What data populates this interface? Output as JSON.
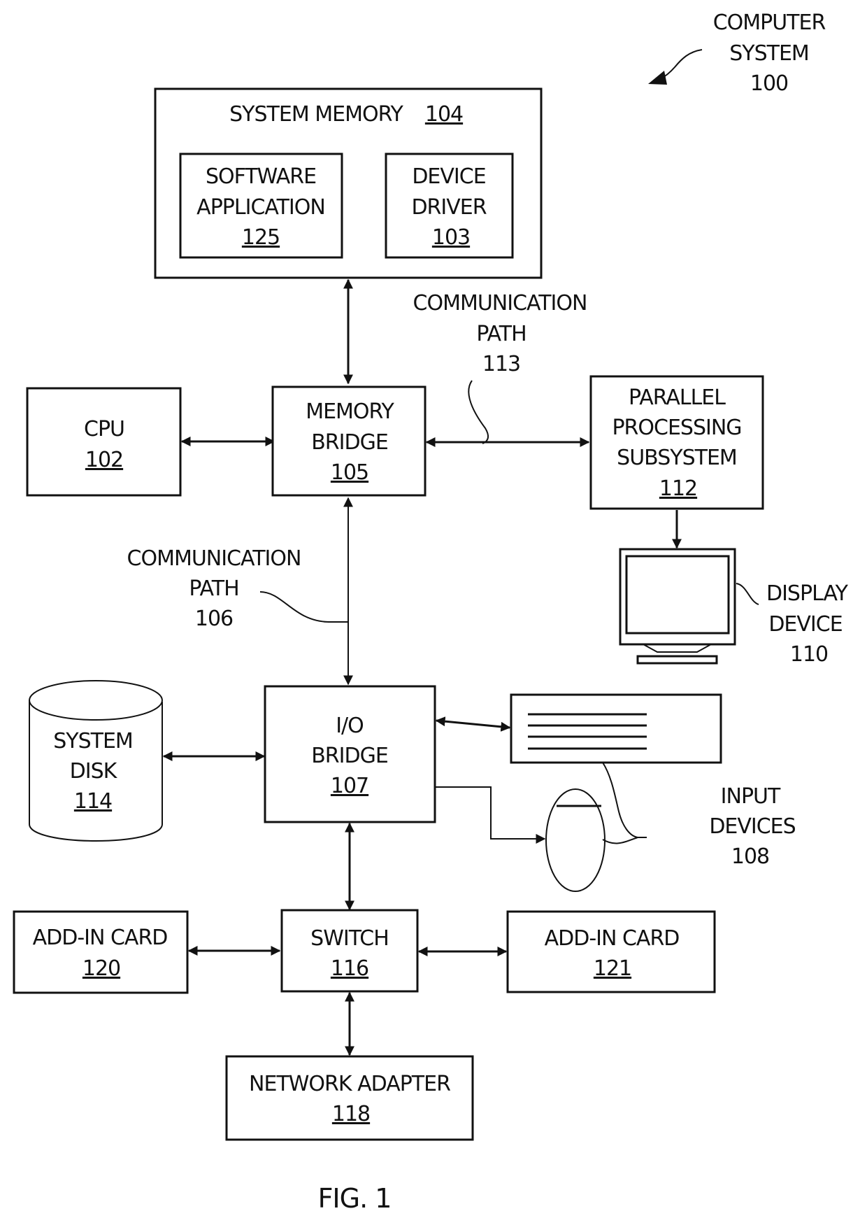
{
  "figure": {
    "caption": "FIG. 1",
    "title_lines": [
      "COMPUTER",
      "SYSTEM",
      "100"
    ]
  },
  "blocks": {
    "system_memory": {
      "name": "SYSTEM MEMORY",
      "ref": "104"
    },
    "software_application": {
      "lines": [
        "SOFTWARE",
        "APPLICATION"
      ],
      "ref": "125"
    },
    "device_driver": {
      "lines": [
        "DEVICE",
        "DRIVER"
      ],
      "ref": "103"
    },
    "cpu": {
      "lines": [
        "CPU"
      ],
      "ref": "102"
    },
    "memory_bridge": {
      "lines": [
        "MEMORY",
        "BRIDGE"
      ],
      "ref": "105"
    },
    "parallel_processing": {
      "lines": [
        "PARALLEL",
        "PROCESSING",
        "SUBSYSTEM"
      ],
      "ref": "112"
    },
    "display_device": {
      "lines": [
        "DISPLAY",
        "DEVICE",
        "110"
      ]
    },
    "system_disk": {
      "lines": [
        "SYSTEM",
        "DISK"
      ],
      "ref": "114"
    },
    "io_bridge": {
      "lines": [
        "I/O",
        "BRIDGE"
      ],
      "ref": "107"
    },
    "input_devices": {
      "lines": [
        "INPUT",
        "DEVICES",
        "108"
      ]
    },
    "add_in_card_120": {
      "lines": [
        "ADD-IN CARD"
      ],
      "ref": "120"
    },
    "switch": {
      "lines": [
        "SWITCH"
      ],
      "ref": "116"
    },
    "add_in_card_121": {
      "lines": [
        "ADD-IN CARD"
      ],
      "ref": "121"
    },
    "network_adapter": {
      "lines": [
        "NETWORK ADAPTER"
      ],
      "ref": "118"
    }
  },
  "paths": {
    "comm_113": {
      "lines": [
        "COMMUNICATION",
        "PATH",
        "113"
      ]
    },
    "comm_106": {
      "lines": [
        "COMMUNICATION",
        "PATH",
        "106"
      ]
    }
  }
}
